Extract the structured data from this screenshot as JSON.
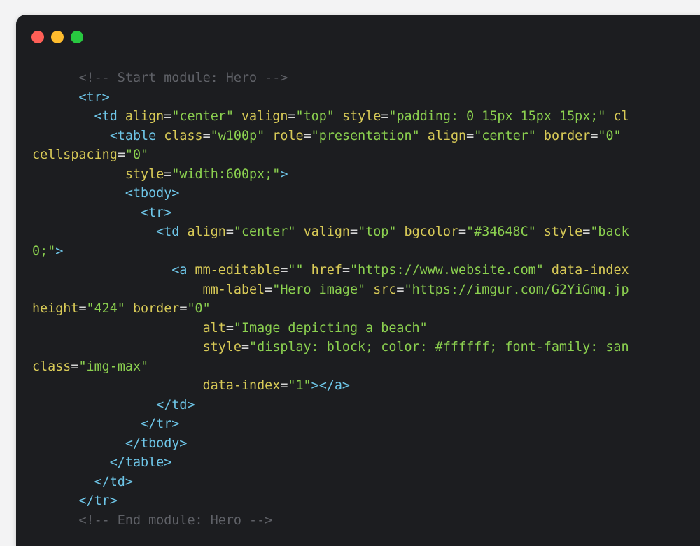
{
  "window": {
    "controls": [
      {
        "name": "close",
        "color": "#fe5f57"
      },
      {
        "name": "minimize",
        "color": "#febc2e"
      },
      {
        "name": "maximize",
        "color": "#28c840"
      }
    ]
  },
  "code_lines": [
    [
      {
        "k": "p",
        "v": "      "
      },
      {
        "k": "c",
        "v": "<!-- Start module: Hero -->"
      }
    ],
    [
      {
        "k": "p",
        "v": "      "
      },
      {
        "k": "t",
        "v": "<tr>"
      }
    ],
    [
      {
        "k": "p",
        "v": "        "
      },
      {
        "k": "t",
        "v": "<td "
      },
      {
        "k": "a",
        "v": "align"
      },
      {
        "k": "p",
        "v": "="
      },
      {
        "k": "s",
        "v": "\"center\""
      },
      {
        "k": "p",
        "v": " "
      },
      {
        "k": "a",
        "v": "valign"
      },
      {
        "k": "p",
        "v": "="
      },
      {
        "k": "s",
        "v": "\"top\""
      },
      {
        "k": "p",
        "v": " "
      },
      {
        "k": "a",
        "v": "style"
      },
      {
        "k": "p",
        "v": "="
      },
      {
        "k": "s",
        "v": "\"padding: 0 15px 15px 15px;\""
      },
      {
        "k": "p",
        "v": " "
      },
      {
        "k": "a",
        "v": "cl"
      }
    ],
    [
      {
        "k": "p",
        "v": "          "
      },
      {
        "k": "t",
        "v": "<table "
      },
      {
        "k": "a",
        "v": "class"
      },
      {
        "k": "p",
        "v": "="
      },
      {
        "k": "s",
        "v": "\"w100p\""
      },
      {
        "k": "p",
        "v": " "
      },
      {
        "k": "a",
        "v": "role"
      },
      {
        "k": "p",
        "v": "="
      },
      {
        "k": "s",
        "v": "\"presentation\""
      },
      {
        "k": "p",
        "v": " "
      },
      {
        "k": "a",
        "v": "align"
      },
      {
        "k": "p",
        "v": "="
      },
      {
        "k": "s",
        "v": "\"center\""
      },
      {
        "k": "p",
        "v": " "
      },
      {
        "k": "a",
        "v": "border"
      },
      {
        "k": "p",
        "v": "="
      },
      {
        "k": "s",
        "v": "\"0\""
      }
    ],
    [
      {
        "k": "a",
        "v": "cellspacing"
      },
      {
        "k": "p",
        "v": "="
      },
      {
        "k": "s",
        "v": "\"0\""
      }
    ],
    [
      {
        "k": "p",
        "v": "            "
      },
      {
        "k": "a",
        "v": "style"
      },
      {
        "k": "p",
        "v": "="
      },
      {
        "k": "s",
        "v": "\"width:600px;\""
      },
      {
        "k": "t",
        "v": ">"
      }
    ],
    [
      {
        "k": "p",
        "v": "            "
      },
      {
        "k": "t",
        "v": "<tbody>"
      }
    ],
    [
      {
        "k": "p",
        "v": "              "
      },
      {
        "k": "t",
        "v": "<tr>"
      }
    ],
    [
      {
        "k": "p",
        "v": "                "
      },
      {
        "k": "t",
        "v": "<td "
      },
      {
        "k": "a",
        "v": "align"
      },
      {
        "k": "p",
        "v": "="
      },
      {
        "k": "s",
        "v": "\"center\""
      },
      {
        "k": "p",
        "v": " "
      },
      {
        "k": "a",
        "v": "valign"
      },
      {
        "k": "p",
        "v": "="
      },
      {
        "k": "s",
        "v": "\"top\""
      },
      {
        "k": "p",
        "v": " "
      },
      {
        "k": "a",
        "v": "bgcolor"
      },
      {
        "k": "p",
        "v": "="
      },
      {
        "k": "s",
        "v": "\"#34648C\""
      },
      {
        "k": "p",
        "v": " "
      },
      {
        "k": "a",
        "v": "style"
      },
      {
        "k": "p",
        "v": "="
      },
      {
        "k": "s",
        "v": "\"back"
      }
    ],
    [
      {
        "k": "s",
        "v": "0;\""
      },
      {
        "k": "t",
        "v": ">"
      }
    ],
    [
      {
        "k": "p",
        "v": "                  "
      },
      {
        "k": "t",
        "v": "<a "
      },
      {
        "k": "a",
        "v": "mm-editable"
      },
      {
        "k": "p",
        "v": "="
      },
      {
        "k": "s",
        "v": "\"\""
      },
      {
        "k": "p",
        "v": " "
      },
      {
        "k": "a",
        "v": "href"
      },
      {
        "k": "p",
        "v": "="
      },
      {
        "k": "s",
        "v": "\"https://www.website.com\""
      },
      {
        "k": "p",
        "v": " "
      },
      {
        "k": "a",
        "v": "data-index"
      }
    ],
    [
      {
        "k": "p",
        "v": "                      "
      },
      {
        "k": "a",
        "v": "mm-label"
      },
      {
        "k": "p",
        "v": "="
      },
      {
        "k": "s",
        "v": "\"Hero image\""
      },
      {
        "k": "p",
        "v": " "
      },
      {
        "k": "a",
        "v": "src"
      },
      {
        "k": "p",
        "v": "="
      },
      {
        "k": "s",
        "v": "\"https://imgur.com/G2YiGmq.jp"
      }
    ],
    [
      {
        "k": "a",
        "v": "height"
      },
      {
        "k": "p",
        "v": "="
      },
      {
        "k": "s",
        "v": "\"424\""
      },
      {
        "k": "p",
        "v": " "
      },
      {
        "k": "a",
        "v": "border"
      },
      {
        "k": "p",
        "v": "="
      },
      {
        "k": "s",
        "v": "\"0\""
      }
    ],
    [
      {
        "k": "p",
        "v": "                      "
      },
      {
        "k": "a",
        "v": "alt"
      },
      {
        "k": "p",
        "v": "="
      },
      {
        "k": "s",
        "v": "\"Image depicting a beach\""
      }
    ],
    [
      {
        "k": "p",
        "v": "                      "
      },
      {
        "k": "a",
        "v": "style"
      },
      {
        "k": "p",
        "v": "="
      },
      {
        "k": "s",
        "v": "\"display: block; color: #ffffff; font-family: san"
      }
    ],
    [
      {
        "k": "a",
        "v": "class"
      },
      {
        "k": "p",
        "v": "="
      },
      {
        "k": "s",
        "v": "\"img-max\""
      }
    ],
    [
      {
        "k": "p",
        "v": "                      "
      },
      {
        "k": "a",
        "v": "data-index"
      },
      {
        "k": "p",
        "v": "="
      },
      {
        "k": "s",
        "v": "\"1\""
      },
      {
        "k": "t",
        "v": "></a>"
      }
    ],
    [
      {
        "k": "p",
        "v": "                "
      },
      {
        "k": "t",
        "v": "</td>"
      }
    ],
    [
      {
        "k": "p",
        "v": "              "
      },
      {
        "k": "t",
        "v": "</tr>"
      }
    ],
    [
      {
        "k": "p",
        "v": "            "
      },
      {
        "k": "t",
        "v": "</tbody>"
      }
    ],
    [
      {
        "k": "p",
        "v": "          "
      },
      {
        "k": "t",
        "v": "</table>"
      }
    ],
    [
      {
        "k": "p",
        "v": "        "
      },
      {
        "k": "t",
        "v": "</td>"
      }
    ],
    [
      {
        "k": "p",
        "v": "      "
      },
      {
        "k": "t",
        "v": "</tr>"
      }
    ],
    [
      {
        "k": "p",
        "v": "      "
      },
      {
        "k": "c",
        "v": "<!-- End module: Hero -->"
      }
    ]
  ]
}
